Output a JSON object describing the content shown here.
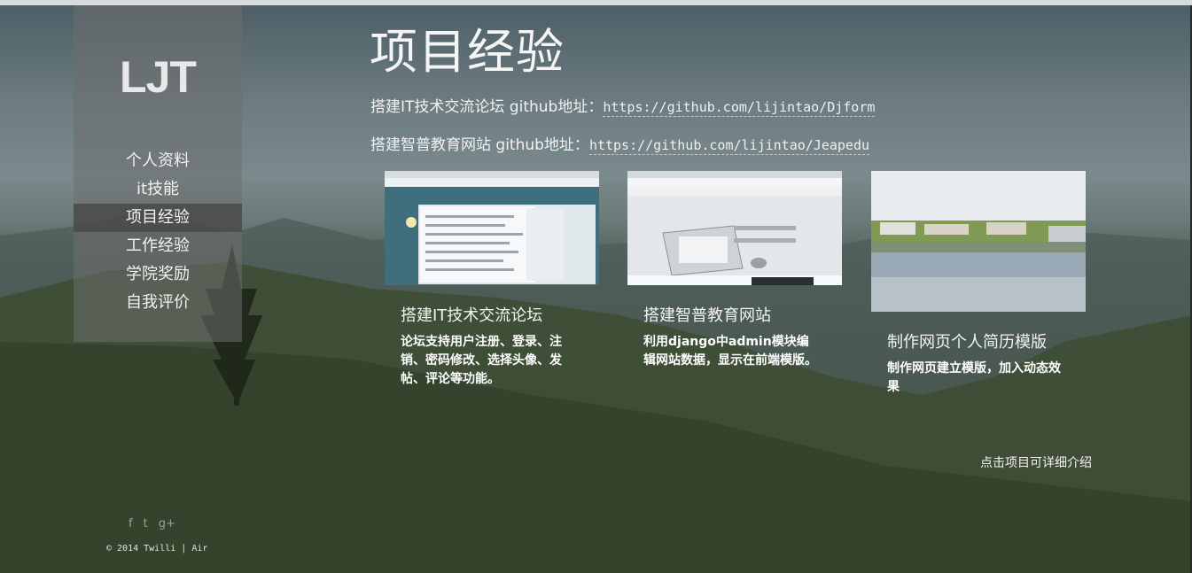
{
  "sidebar": {
    "logo": "LJT",
    "nav": [
      "个人资料",
      "it技能",
      "项目经验",
      "工作经验",
      "学院奖励",
      "自我评价"
    ],
    "active_index": 2
  },
  "social": {
    "icons": [
      "facebook-icon",
      "twitter-icon",
      "google-plus-icon"
    ],
    "glyphs": [
      "f",
      "t",
      "g+"
    ]
  },
  "footer": "© 2014 Twilli | Air",
  "main": {
    "title": "项目经验",
    "links": [
      {
        "label": "搭建IT技术交流论坛 github地址：",
        "url": "https://github.com/lijintao/Djform"
      },
      {
        "label": "搭建智普教育网站 github地址：",
        "url": "https://github.com/lijintao/Jeapedu"
      }
    ],
    "projects": [
      {
        "title": "搭建IT技术交流论坛",
        "desc": "论坛支持用户注册、登录、注销、密码修改、选择头像、发帖、评论等功能。"
      },
      {
        "title": "搭建智普教育网站",
        "desc": "利用django中admin模块编辑网站数据，显示在前端模版。"
      },
      {
        "title": "制作网页个人简历模版",
        "desc": "制作网页建立模版，加入动态效果"
      }
    ],
    "hint": "点击项目可详细介绍"
  },
  "colors": {
    "sidebar_bg": "#6e6e6e",
    "active_bg": "#464646",
    "text": "#ffffff"
  }
}
